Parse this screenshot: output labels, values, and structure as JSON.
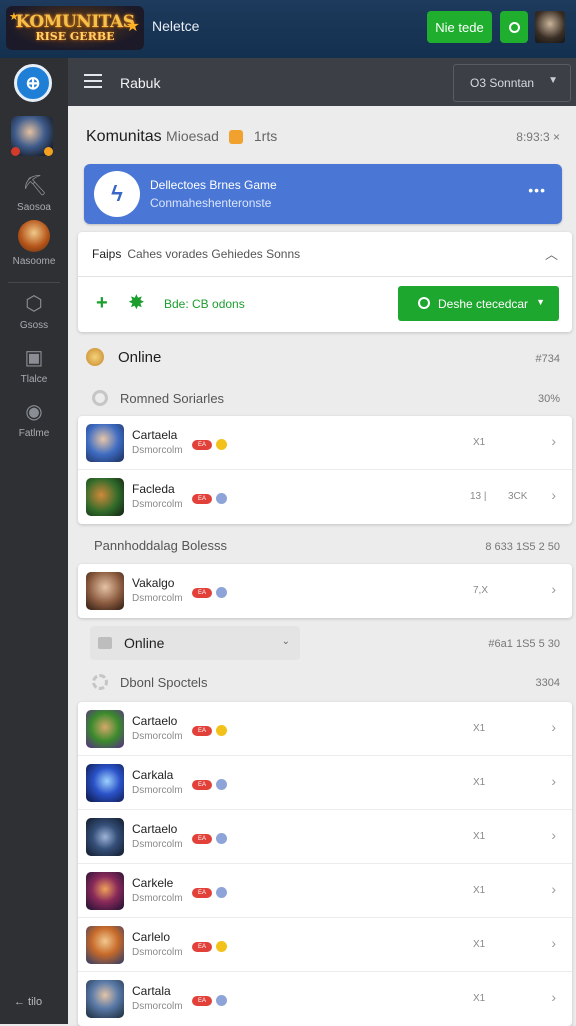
{
  "topbar": {
    "logo_line1": "KOMUNITAS",
    "logo_line2": "RISE GERBE",
    "title": "Neletce",
    "button": "Nie tede"
  },
  "sidebar": {
    "items": [
      {
        "label": "Saosoa",
        "icon": "cap-icon"
      },
      {
        "label": "Nasoome",
        "icon": "avatar-icon"
      },
      {
        "label": "Gsoss",
        "icon": "handshake-icon"
      },
      {
        "label": "Tlalce",
        "icon": "card-icon"
      },
      {
        "label": "Fatlme",
        "icon": "globe-icon"
      }
    ],
    "bottom": "← tilo"
  },
  "header": {
    "title": "Rabuk",
    "dropdown": "O3 Sonntan"
  },
  "subheader": {
    "title": "Komunitas",
    "muted": "Mioesad",
    "count": "1rts",
    "right": "8:93:3 ×"
  },
  "banner": {
    "title": "Dellectoes Brnes Game",
    "subtitle": "Conmaheshenteronste",
    "more": "•••"
  },
  "filter": {
    "label": "Faips",
    "value": "Cahes vorades Gehiedes Sonns",
    "link_text": "Bde: CB odons",
    "button": "Deshe ctecedcar"
  },
  "online_section": {
    "label": "Online",
    "count": "#734"
  },
  "group1": {
    "label": "Romned Soriarles",
    "count": "30%"
  },
  "group1_rows": [
    {
      "name": "Cartaela",
      "sub": "Dsmorcolm",
      "tag": "EA",
      "meta": "X1",
      "extra": ""
    },
    {
      "name": "Facleda",
      "sub": "Dsmorcolm",
      "tag": "EA",
      "meta": "3CK",
      "extra": "13 |"
    }
  ],
  "group2": {
    "label": "Pannhoddalag Bolesss",
    "count": "8 633   1S5 2 50"
  },
  "group2_rows": [
    {
      "name": "Vakalgo",
      "sub": "Dsmorcolm",
      "tag": "EA",
      "meta": "7,X",
      "extra": ""
    }
  ],
  "online2": {
    "label": "Online",
    "count": "#6a1   1S5 5 30"
  },
  "group3": {
    "label": "Dbonl Spoctels",
    "count": "3304"
  },
  "group3_rows": [
    {
      "name": "Cartaelo",
      "sub": "Dsmorcolm",
      "tag": "EA",
      "meta": "X1"
    },
    {
      "name": "Carkala",
      "sub": "Dsmorcolm",
      "tag": "EA",
      "meta": "X1"
    },
    {
      "name": "Cartaelo",
      "sub": "Dsmorcolm",
      "tag": "EA",
      "meta": "X1"
    },
    {
      "name": "Carkele",
      "sub": "Dsmorcolm",
      "tag": "EA",
      "meta": "X1"
    },
    {
      "name": "Carlelo",
      "sub": "Dsmorcolm",
      "tag": "EA",
      "meta": "X1"
    },
    {
      "name": "Cartala",
      "sub": "Dsmorcolm",
      "tag": "EA",
      "meta": "X1"
    }
  ],
  "colors": {
    "accent": "#1fae2e",
    "banner": "#4a77d6",
    "sidebar": "#2e3033",
    "topbar": "#1a3556"
  }
}
